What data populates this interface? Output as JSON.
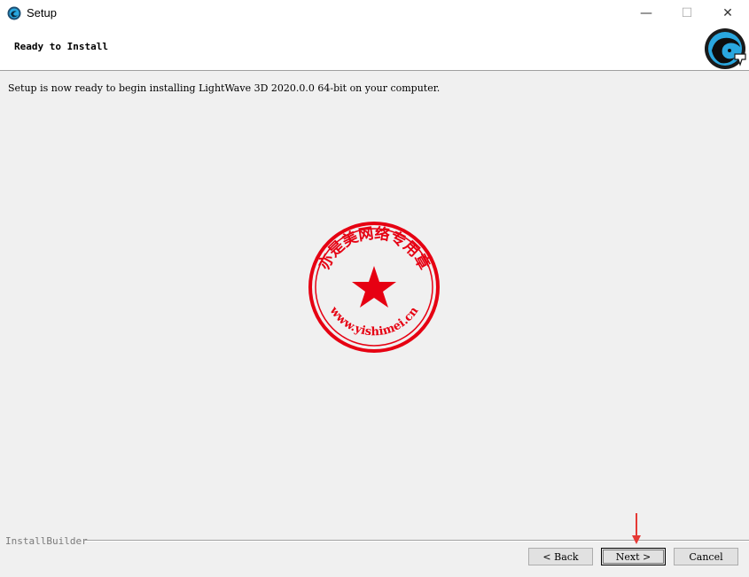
{
  "window": {
    "title": "Setup",
    "controls": {
      "minimize": "—",
      "maximize": "☐",
      "close": "✕"
    }
  },
  "header": {
    "title": "Ready to Install"
  },
  "content": {
    "message": "Setup is now ready to begin installing LightWave 3D 2020.0.0 64-bit on your computer."
  },
  "watermark": {
    "text_top": "亦是美网络专用章",
    "text_bottom": "www.yishimei.cn",
    "color": "#e60012"
  },
  "footer": {
    "brand": "InstallBuilder",
    "buttons": {
      "back": "< Back",
      "next": "Next >",
      "cancel": "Cancel"
    }
  },
  "annotation": {
    "color": "#e53935"
  }
}
